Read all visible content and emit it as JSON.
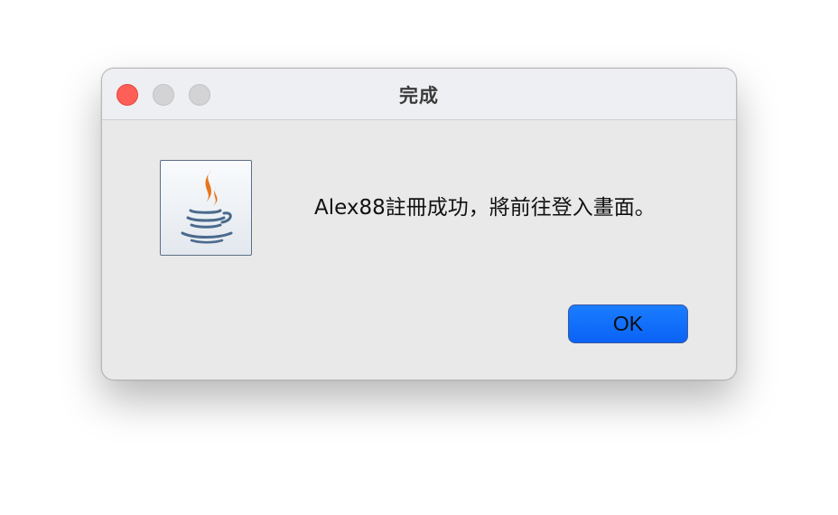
{
  "window": {
    "title": "完成",
    "traffic_lights": {
      "close": "#fe5f57",
      "minimize": "#d3d3d6",
      "zoom": "#d3d3d6"
    }
  },
  "dialog": {
    "icon": "java-coffee-cup-icon",
    "message": "Alex88註冊成功，將前往登入畫面。",
    "ok_label": "OK",
    "accent_color": "#0a62f5"
  }
}
